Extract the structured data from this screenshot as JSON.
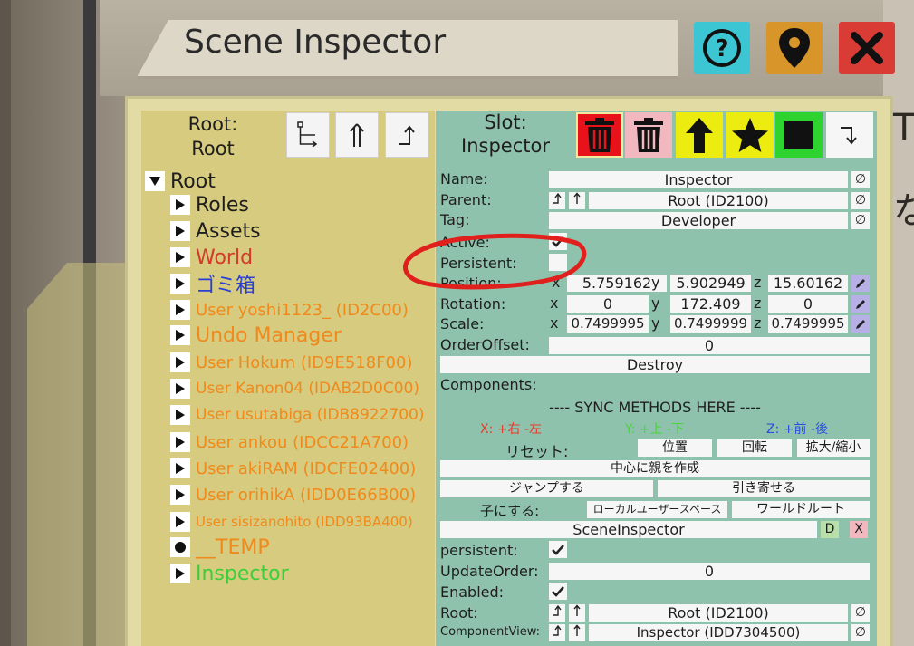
{
  "window": {
    "title": "Scene Inspector",
    "buttons": {
      "help_icon": "question-icon",
      "locate_icon": "map-pin-icon",
      "close_icon": "close-icon"
    }
  },
  "hierarchy": {
    "header": {
      "line1": "Root:",
      "line2": "Root"
    },
    "items": [
      {
        "label": "Root",
        "color": "#1e1e1e",
        "expanded": true,
        "indent": 0
      },
      {
        "label": "Roles",
        "color": "#1e1e1e",
        "indent": 1
      },
      {
        "label": "Assets",
        "color": "#1e1e1e",
        "indent": 1
      },
      {
        "label": "World",
        "color": "#d43a2a",
        "indent": 1
      },
      {
        "label": "ゴミ箱",
        "color": "#2a3fd4",
        "indent": 1
      },
      {
        "label": "User yoshi1123_ (ID2C00)",
        "color": "#f08a1c",
        "indent": 1,
        "size": 18
      },
      {
        "label": "Undo Manager",
        "color": "#f08a1c",
        "indent": 1
      },
      {
        "label": "User Hokum (ID9E518F00)",
        "color": "#f08a1c",
        "indent": 1,
        "size": 18
      },
      {
        "label": "User Kanon04 (IDAB2D0C00)",
        "color": "#f08a1c",
        "indent": 1,
        "size": 17
      },
      {
        "label": "User usutabiga (IDB8922700)",
        "color": "#f08a1c",
        "indent": 1,
        "size": 17
      },
      {
        "label": "User ankou (IDCC21A700)",
        "color": "#f08a1c",
        "indent": 1,
        "size": 18
      },
      {
        "label": "User akiRAM (IDCFE02400)",
        "color": "#f08a1c",
        "indent": 1,
        "size": 18
      },
      {
        "label": "User orihikA (IDD0E66B00)",
        "color": "#f08a1c",
        "indent": 1,
        "size": 18
      },
      {
        "label": "User sisizanohito (IDD93BA400)",
        "color": "#f08a1c",
        "indent": 1,
        "size": 15
      },
      {
        "label": "__TEMP",
        "color": "#f08a1c",
        "indent": 1,
        "dot": true
      },
      {
        "label": "Inspector",
        "color": "#3ccf3a",
        "indent": 1
      }
    ]
  },
  "slot": {
    "header": {
      "line1": "Slot:",
      "line2": "Inspector"
    },
    "name": {
      "label": "Name:",
      "value": "Inspector"
    },
    "parent": {
      "label": "Parent:",
      "value": "Root (ID2100)"
    },
    "tag": {
      "label": "Tag:",
      "value": "Developer"
    },
    "active": {
      "label": "Active:"
    },
    "persistent": {
      "label": "Persistent:"
    },
    "position": {
      "label": "Position:",
      "x": "5.759162",
      "y": "5.902949",
      "z": "15.60162"
    },
    "rotation": {
      "label": "Rotation:",
      "x": "0",
      "y": "172.409",
      "z": "0"
    },
    "scale": {
      "label": "Scale:",
      "x": "0.7499995",
      "y": "0.7499999",
      "z": "0.7499995"
    },
    "order_offset": {
      "label": "OrderOffset:",
      "value": "0"
    },
    "destroy": "Destroy",
    "components_label": "Components:",
    "axis_labels": {
      "x": "x",
      "y": "y",
      "z": "z"
    },
    "clear_symbol": "∅"
  },
  "component": {
    "sync_header": "---- SYNC METHODS HERE ----",
    "axis_x": "X: +右 -左",
    "axis_y": "Y: +上 -下",
    "axis_z": "Z: +前 -後",
    "reset_label": "リセット:",
    "reset_position": "位置",
    "reset_rotation": "回転",
    "reset_scale": "拡大/縮小",
    "create_parent": "中心に親を作成",
    "jump": "ジャンプする",
    "pull": "引き寄せる",
    "make_child_label": "子にする:",
    "local_user_space": "ローカルユーザースペース",
    "world_root": "ワールドルート",
    "name": "SceneInspector",
    "d_button": "D",
    "x_button": "X",
    "persistent_label": "persistent:",
    "update_order_label": "UpdateOrder:",
    "update_order_value": "0",
    "enabled_label": "Enabled:",
    "root_label": "Root:",
    "root_value": "Root (ID2100)",
    "component_view_label": "ComponentView:",
    "component_view_value": "Inspector (IDD7304500)"
  },
  "colors": {
    "axis_x": "#e53a2a",
    "axis_y": "#4ad43a",
    "axis_z": "#2a4ee0",
    "annotation": "#e0201c"
  }
}
